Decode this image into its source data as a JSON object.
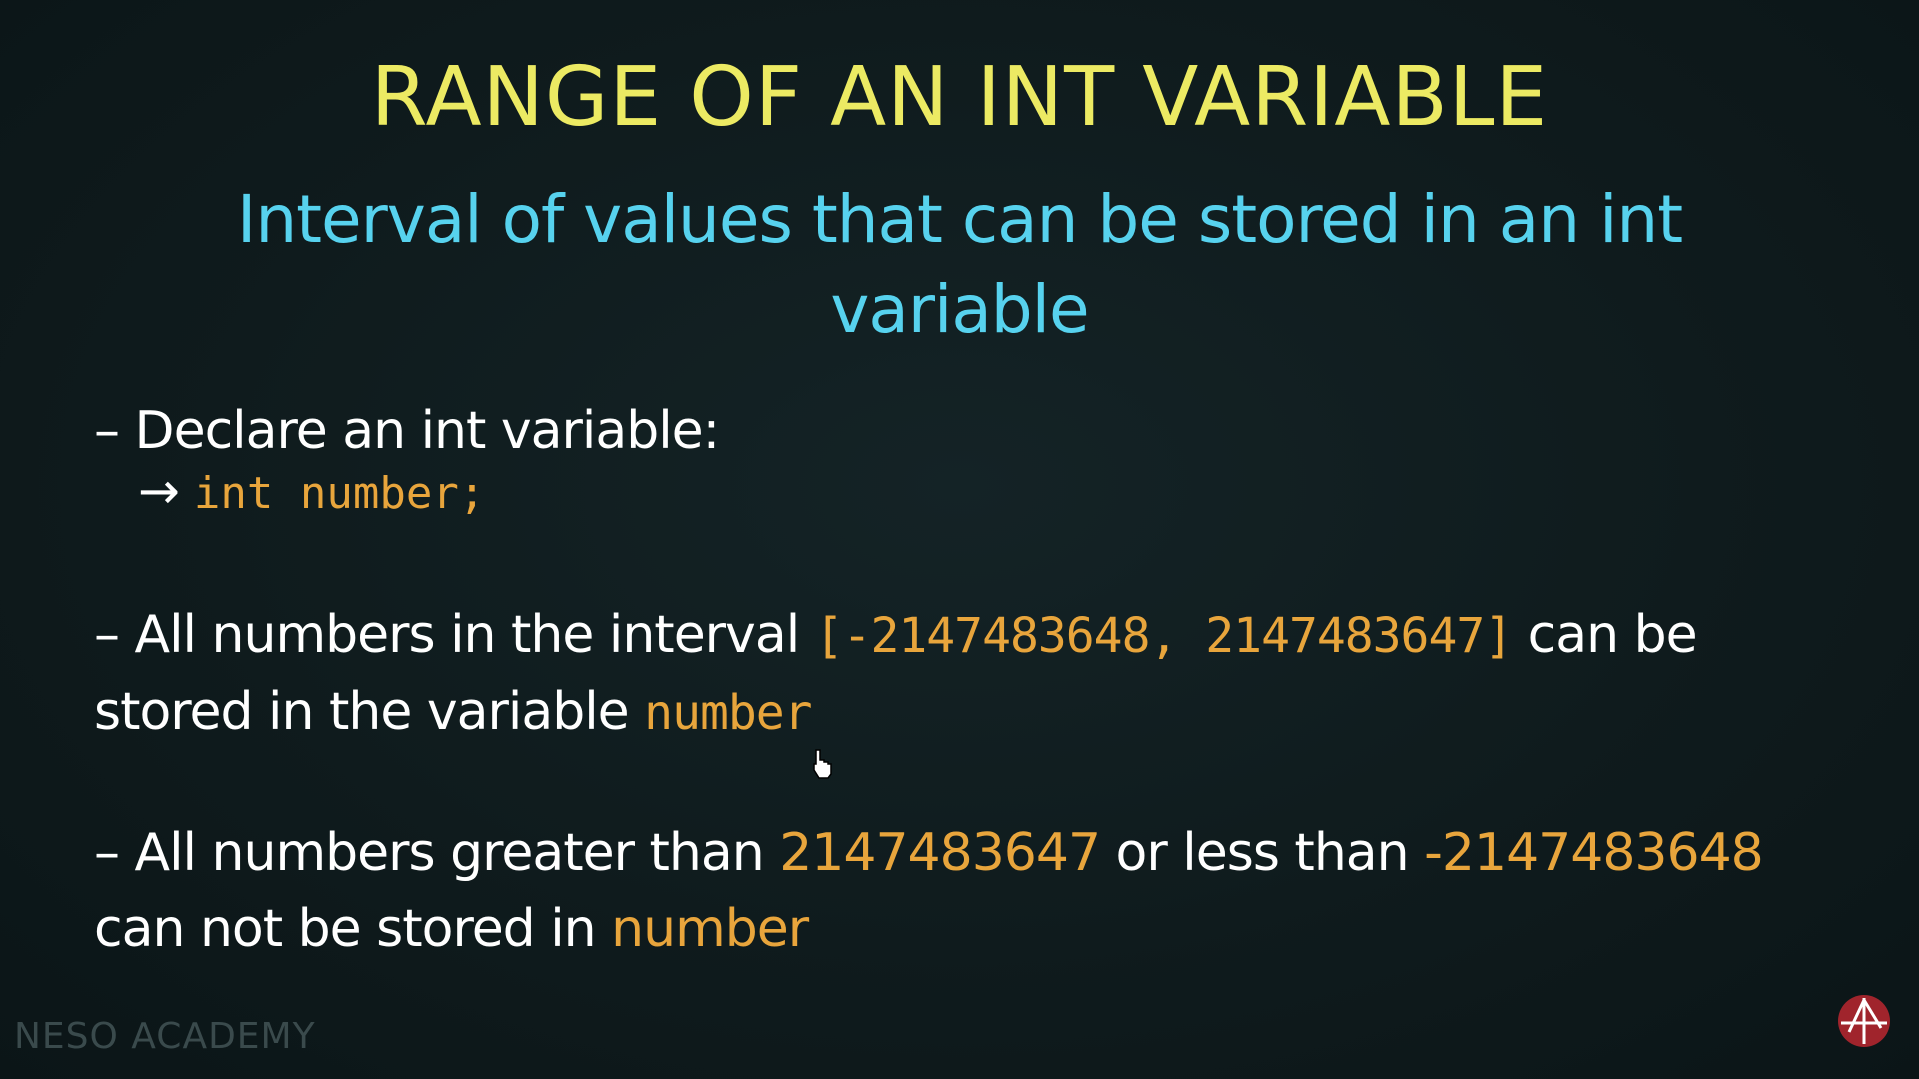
{
  "slide": {
    "title": "RANGE OF AN INT VARIABLE",
    "subtitle": "Interval of values that can be stored in an int variable",
    "bullet1": {
      "text": "– Declare an int variable:",
      "arrow": "→",
      "code": "int number;"
    },
    "bullet2": {
      "prefix": "– All numbers in the interval ",
      "interval": "[-2147483648, 2147483647]",
      "middle": " can be stored in the variable ",
      "var": "number"
    },
    "bullet3": {
      "prefix": "– All numbers greater than ",
      "max": "2147483647",
      "middle": " or less than ",
      "min": "-2147483648",
      "suffix": " can not be stored in ",
      "var": "number"
    },
    "watermark": "NESO ACADEMY"
  },
  "colors": {
    "title": "#ecea63",
    "subtitle": "#57d2ee",
    "highlight": "#e8a53c",
    "text": "#ffffff",
    "background": "#0f1b1d"
  },
  "icons": {
    "logo": "neso-logo-icon",
    "cursor": "mouse-cursor-icon"
  }
}
